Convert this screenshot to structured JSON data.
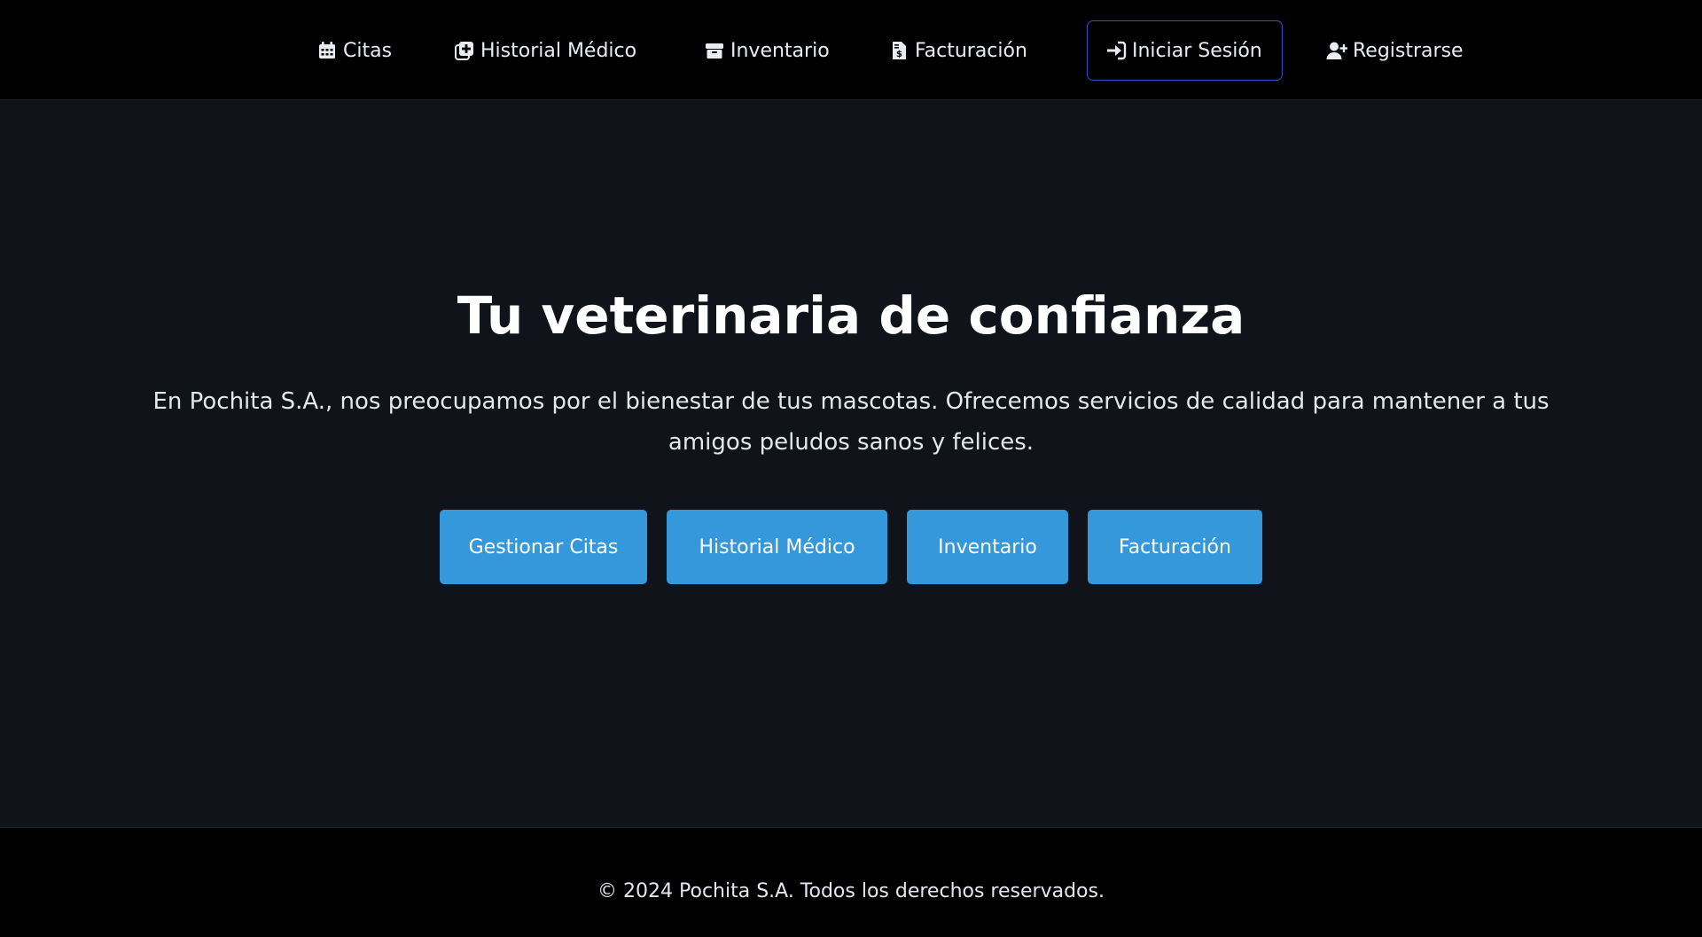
{
  "nav": {
    "items": [
      {
        "label": "Citas",
        "icon": "calendar-icon"
      },
      {
        "label": "Historial Médico",
        "icon": "medical-notes-icon"
      },
      {
        "label": "Inventario",
        "icon": "box-icon"
      },
      {
        "label": "Facturación",
        "icon": "invoice-icon"
      },
      {
        "label": "Iniciar Sesión",
        "icon": "sign-in-icon"
      },
      {
        "label": "Registrarse",
        "icon": "user-plus-icon"
      }
    ]
  },
  "hero": {
    "title": "Tu veterinaria de confianza",
    "description": "En Pochita S.A., nos preocupamos por el bienestar de tus mascotas. Ofrecemos servicios de calidad para mantener a tus amigos peludos sanos y felices.",
    "buttons": [
      {
        "label": "Gestionar Citas"
      },
      {
        "label": "Historial Médico"
      },
      {
        "label": "Inventario"
      },
      {
        "label": "Facturación"
      }
    ]
  },
  "footer": {
    "text": "© 2024 Pochita S.A. Todos los derechos reservados."
  },
  "colors": {
    "nav_background": "#000000",
    "page_background": "#11131a",
    "button_background": "#3498db",
    "login_border": "#3b4ec8"
  }
}
